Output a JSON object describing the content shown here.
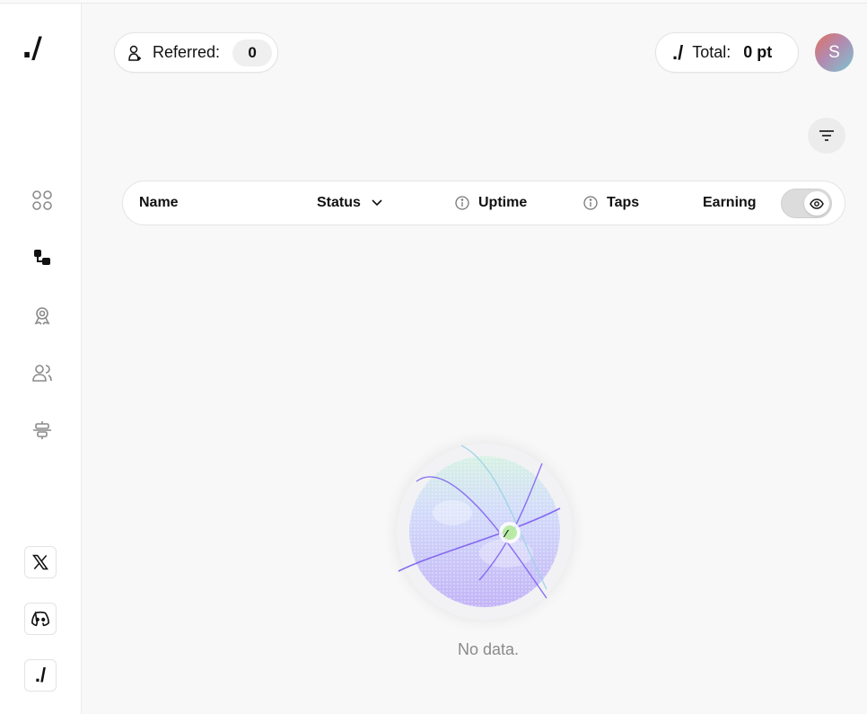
{
  "sidebar": {
    "logo": "./",
    "nav": [
      "dashboard",
      "nodes",
      "rewards",
      "referrals",
      "settings"
    ],
    "socials": [
      "x-twitter",
      "discord",
      "app"
    ],
    "app_logo_text": "./"
  },
  "header": {
    "referred_label": "Referred:",
    "referred_count": "0",
    "total_logo": "./",
    "total_label": "Total:",
    "total_value": "0 pt",
    "avatar_initial": "S"
  },
  "table": {
    "columns": {
      "name": "Name",
      "status": "Status",
      "uptime": "Uptime",
      "taps": "Taps",
      "earning": "Earning"
    },
    "earning_toggle_on": true
  },
  "empty_state": {
    "message": "No data."
  },
  "colors": {
    "globe_purple": "#b9a8f3",
    "orbit": "#7a5cf0",
    "accent_green": "#8fe26a"
  }
}
